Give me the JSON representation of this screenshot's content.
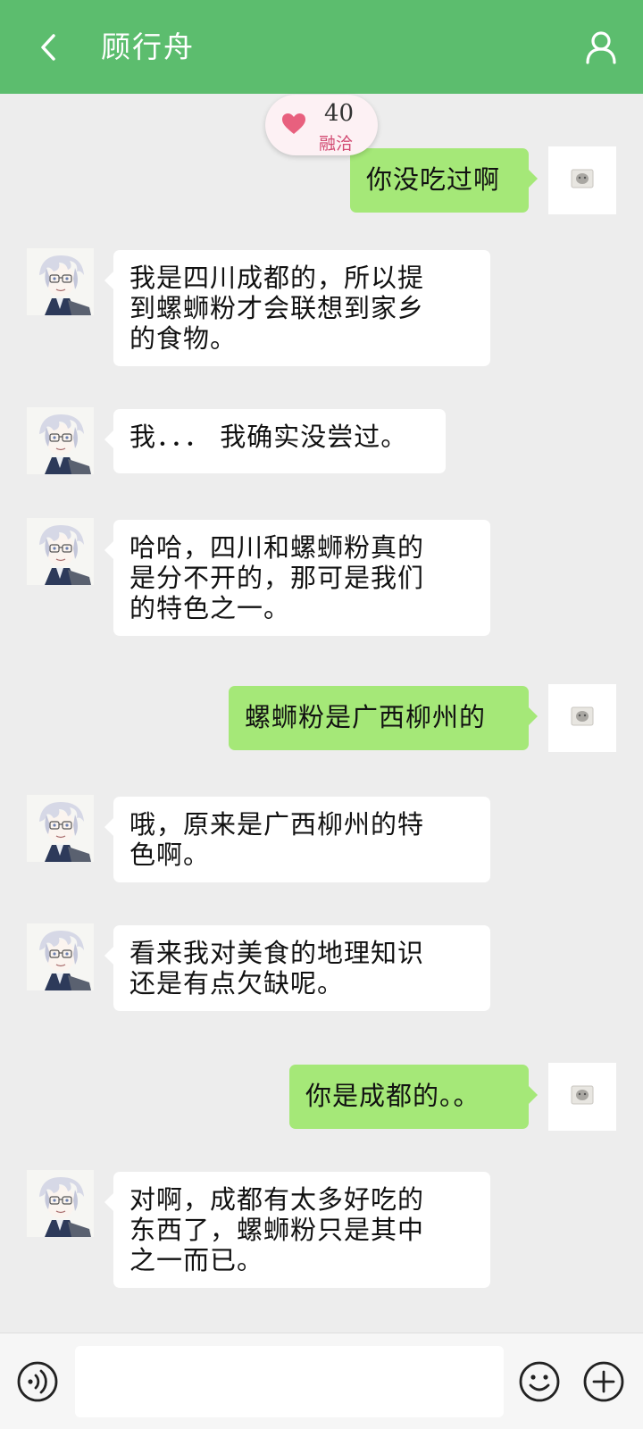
{
  "header": {
    "title": "顾行舟",
    "back_icon": "chevron-left-icon",
    "profile_icon": "user-icon",
    "bg_color": "#5cbd6e"
  },
  "affinity": {
    "score": "40",
    "status": "融洽",
    "icon": "heart-icon",
    "heart_color": "#e8607e"
  },
  "messages": [
    {
      "sender": "me",
      "lines": [
        "你没吃过啊"
      ]
    },
    {
      "sender": "contact",
      "lines": [
        "我是四川成都的，所以提",
        "到螺蛳粉才会联想到家乡",
        "的食物。"
      ]
    },
    {
      "sender": "contact",
      "lines": [
        "我．．． 我确实没尝过。"
      ]
    },
    {
      "sender": "contact",
      "lines": [
        "哈哈，四川和螺蛳粉真的",
        "是分不开的，那可是我们",
        "的特色之一。"
      ]
    },
    {
      "sender": "me",
      "lines": [
        "螺蛳粉是广西柳州的"
      ]
    },
    {
      "sender": "contact",
      "lines": [
        "哦，原来是广西柳州的特",
        "色啊。"
      ]
    },
    {
      "sender": "contact",
      "lines": [
        "看来我对美食的地理知识",
        "还是有点欠缺呢。"
      ]
    },
    {
      "sender": "me",
      "lines": [
        "你是成都的。。"
      ]
    },
    {
      "sender": "contact",
      "lines": [
        "对啊，成都有太多好吃的",
        "东西了，螺蛳粉只是其中",
        "之一而已。"
      ]
    }
  ],
  "input_bar": {
    "placeholder": "",
    "value": "",
    "voice_icon": "voice-icon",
    "emoji_icon": "emoji-icon",
    "plus_icon": "plus-icon"
  },
  "colors": {
    "my_bubble": "#a5e878",
    "their_bubble": "#ffffff",
    "background": "#ededed"
  }
}
